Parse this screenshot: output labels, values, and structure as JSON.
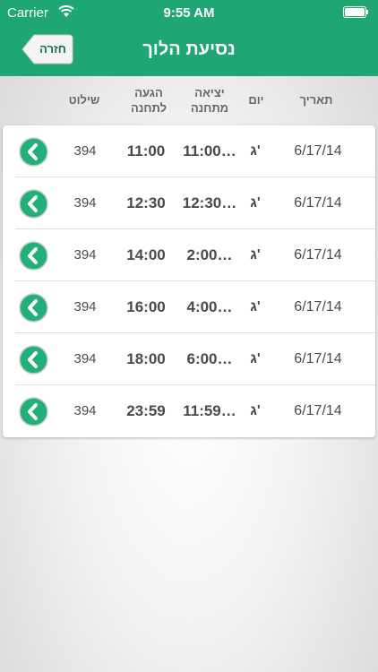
{
  "status_bar": {
    "carrier": "Carrier",
    "time": "9:55 AM"
  },
  "nav": {
    "back_label": "חזרה",
    "title": "נסיעת הלוך"
  },
  "columns": {
    "date": "תאריך",
    "day": "יום",
    "departure_line1": "יציאה",
    "departure_line2": "מתחנה",
    "arrival_line1": "הגעה",
    "arrival_line2": "לתחנה",
    "sign": "שילוט"
  },
  "rows": [
    {
      "date": "6/17/14",
      "day": "ג'",
      "departure": "11:00…",
      "arrival": "11:00",
      "sign": "394"
    },
    {
      "date": "6/17/14",
      "day": "ג'",
      "departure": "12:30…",
      "arrival": "12:30",
      "sign": "394"
    },
    {
      "date": "6/17/14",
      "day": "ג'",
      "departure": "2:00…",
      "arrival": "14:00",
      "sign": "394"
    },
    {
      "date": "6/17/14",
      "day": "ג'",
      "departure": "4:00…",
      "arrival": "16:00",
      "sign": "394"
    },
    {
      "date": "6/17/14",
      "day": "ג'",
      "departure": "6:00…",
      "arrival": "18:00",
      "sign": "394"
    },
    {
      "date": "6/17/14",
      "day": "ג'",
      "departure": "11:59…",
      "arrival": "23:59",
      "sign": "394"
    }
  ],
  "icons": {
    "row_button": "chevron-left-circle-icon",
    "wifi": "wifi-icon",
    "battery": "battery-icon"
  },
  "colors": {
    "header": "#1fa773",
    "accent": "#21b07a"
  }
}
